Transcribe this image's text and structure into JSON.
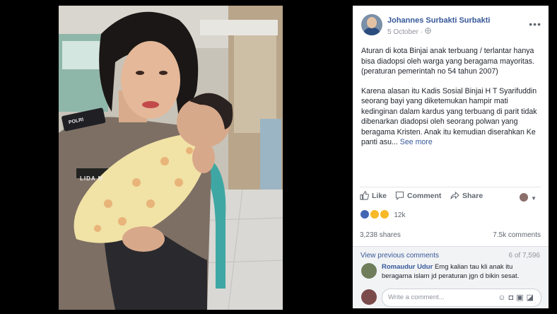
{
  "post": {
    "author": "Johannes Surbakti Surbakti",
    "date": "5 October",
    "date_separator": "·",
    "privacy_icon": "globe-icon",
    "more_icon": "ellipsis-icon",
    "paragraph1": "Aturan di kota Binjai anak terbuang / terlantar hanya bisa diadopsi oleh warga yang beragama mayoritas. (peraturan pemerintah no 54 tahun 2007)",
    "paragraph2": "Karena alasan itu Kadis Sosial Binjai H T Syarifuddin seorang bayi yang diketemukan hampir mati kedinginan dalam kardus yang terbuang di parit tidak dibenarkan diadopsi oleh seorang polwan yang beragama Kristen. Anak itu kemudian diserahkan Ke panti asu...",
    "see_more": "See more"
  },
  "photo": {
    "name_tag": "LIDA M",
    "shoulder_text": "POLRI"
  },
  "actions": {
    "like": "Like",
    "comment": "Comment",
    "share": "Share"
  },
  "reactions": {
    "count": "12k",
    "types": [
      "like",
      "sad",
      "wow"
    ]
  },
  "stats": {
    "shares": "3,238 shares",
    "comments": "7.5k comments"
  },
  "comments": {
    "view_previous": "View previous comments",
    "count": "6 of 7,596",
    "items": [
      {
        "author": "Romaudur Udur",
        "text": "Emg kalian tau kli anak itu beragama islam jd peraturan jgn d bikin sesat."
      }
    ],
    "placeholder": "Write a comment..."
  },
  "colors": {
    "link": "#365899",
    "like_blue": "#4267b2",
    "reaction_yellow": "#f7b928"
  }
}
